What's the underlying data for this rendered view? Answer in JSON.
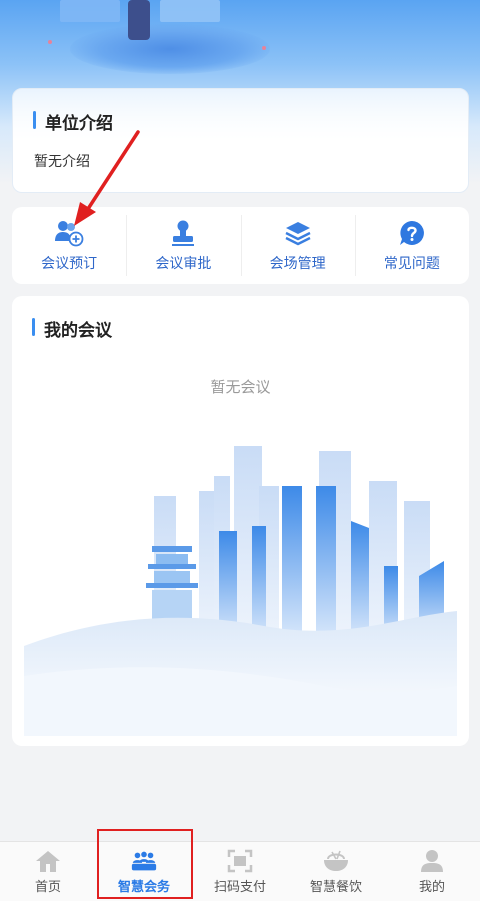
{
  "unit_intro": {
    "title": "单位介绍",
    "text": "暂无介绍"
  },
  "functions": [
    {
      "label": "会议预订",
      "icon": "meeting-booking-icon"
    },
    {
      "label": "会议审批",
      "icon": "approval-stamp-icon"
    },
    {
      "label": "会场管理",
      "icon": "layers-icon"
    },
    {
      "label": "常见问题",
      "icon": "question-icon"
    }
  ],
  "my_meetings": {
    "title": "我的会议",
    "empty_text": "暂无会议"
  },
  "bottom_nav": {
    "items": [
      {
        "label": "首页",
        "icon": "home-icon"
      },
      {
        "label": "智慧会务",
        "icon": "conference-icon",
        "active": true
      },
      {
        "label": "扫码支付",
        "icon": "scan-icon"
      },
      {
        "label": "智慧餐饮",
        "icon": "dining-icon"
      },
      {
        "label": "我的",
        "icon": "user-icon"
      }
    ]
  },
  "colors": {
    "accent": "#3a8ef0",
    "label_blue": "#2f67c9",
    "annotation_red": "#e02020"
  }
}
